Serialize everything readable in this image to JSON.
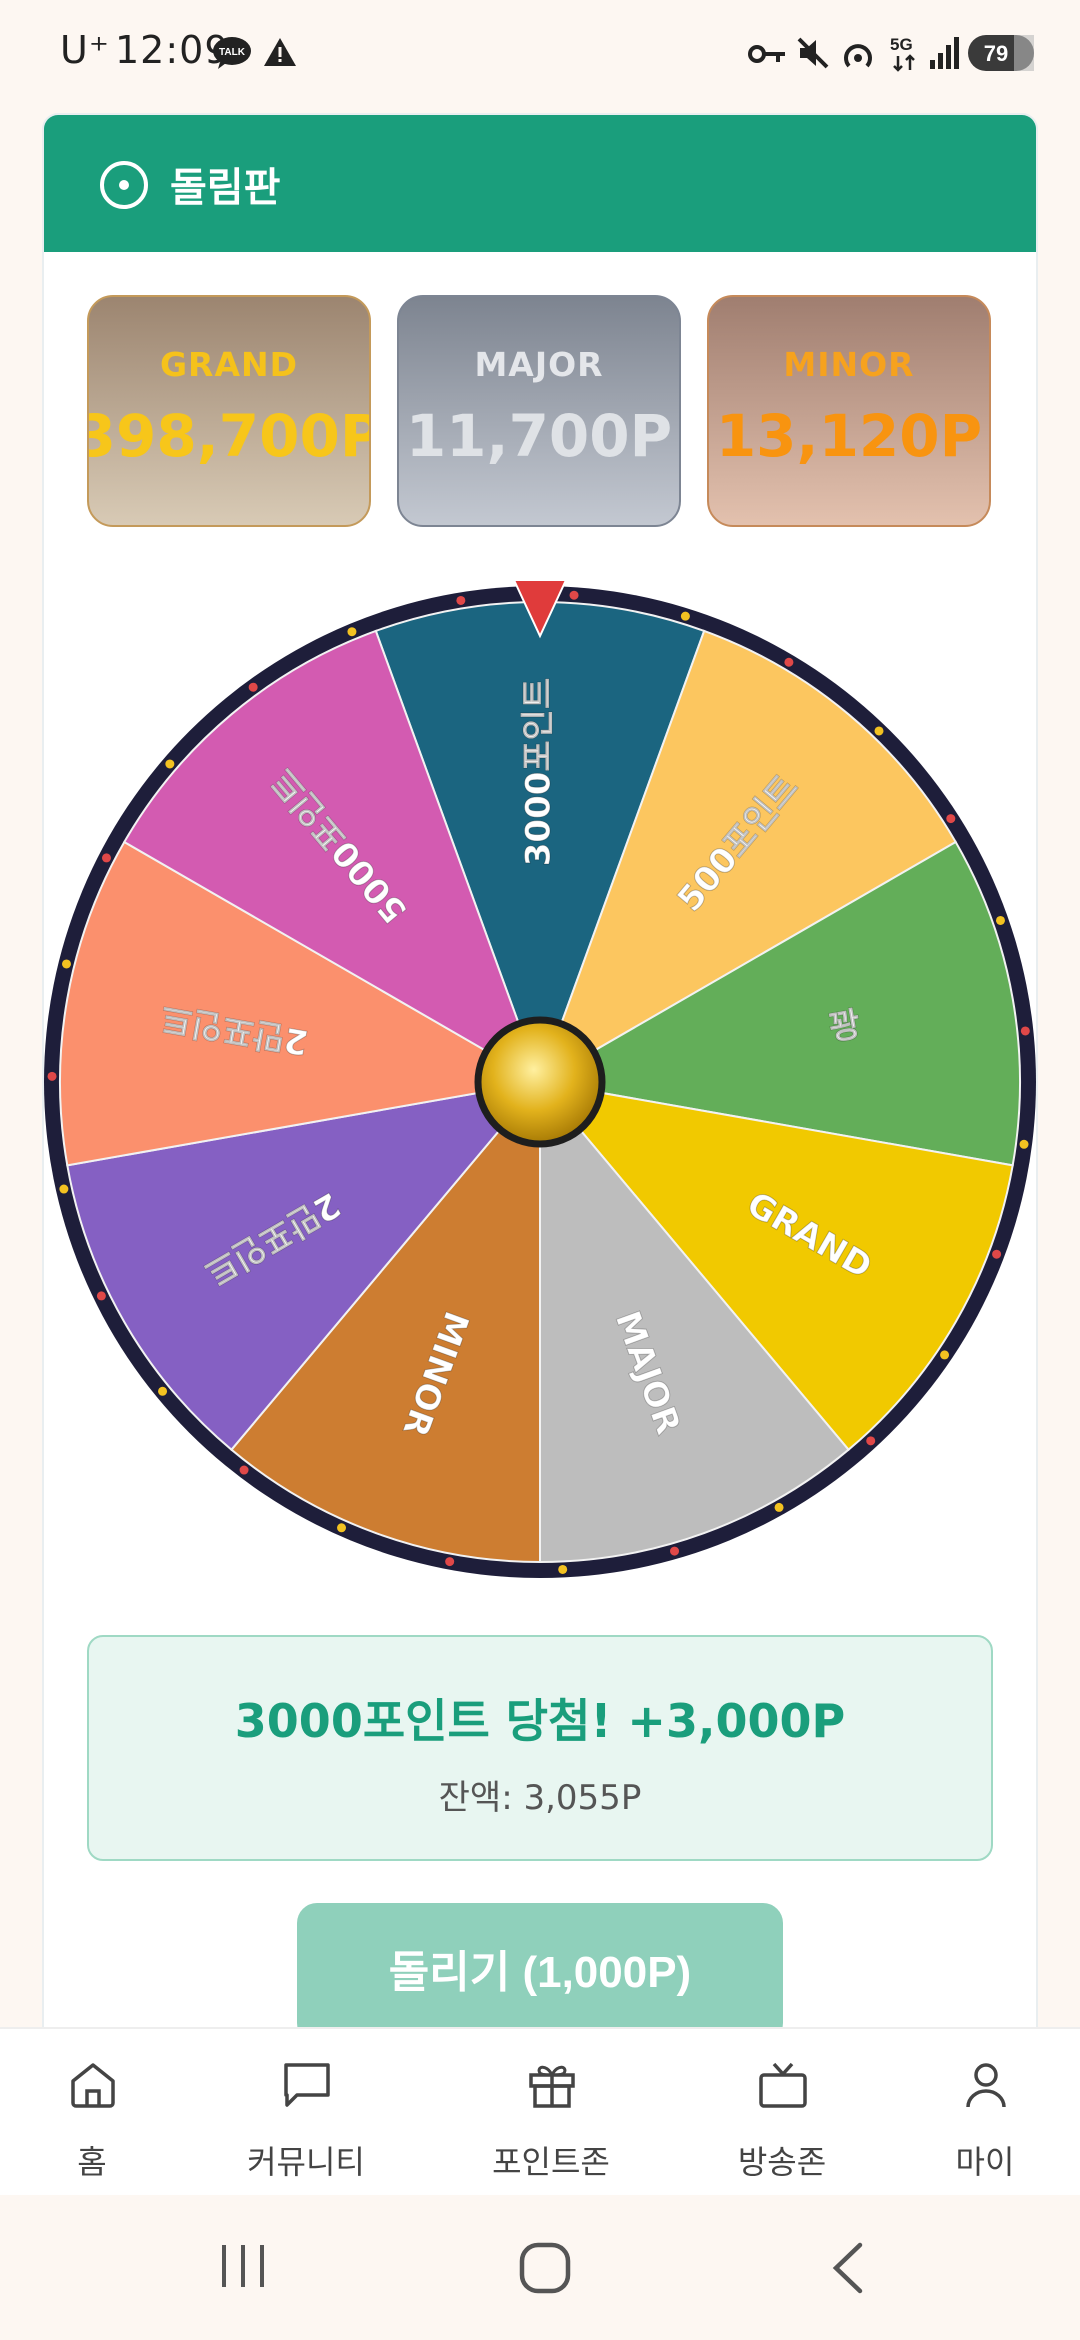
{
  "status_bar": {
    "carrier": "U⁺",
    "time": "12:09",
    "talk_icon_text": "TALK",
    "network": "5G",
    "battery": "79",
    "icons": [
      "kakaotalk-icon",
      "warning-icon",
      "key-icon",
      "mute-icon",
      "hotspot-icon",
      "5g-icon",
      "signal-icon",
      "battery-icon"
    ]
  },
  "card": {
    "title": "돌림판",
    "header_color": "#1a9e7c",
    "jackpots": [
      {
        "label": "GRAND",
        "value": "398,700P"
      },
      {
        "label": "MAJOR",
        "value": "11,700P"
      },
      {
        "label": "MINOR",
        "value": "13,120P"
      }
    ]
  },
  "wheel": {
    "segments": [
      {
        "label": "3000포인트",
        "color": "#1b6580"
      },
      {
        "label": "500포인트",
        "color": "#fcc65f"
      },
      {
        "label": "꽝",
        "color": "#63ae59"
      },
      {
        "label": "GRAND",
        "color": "#f1c900"
      },
      {
        "label": "MAJOR",
        "color": "#bdbdbd"
      },
      {
        "label": "MINOR",
        "color": "#cd7d31"
      },
      {
        "label": "2만포인트",
        "color": "#8560c3"
      },
      {
        "label": "2만포인트",
        "color": "#fb906d"
      },
      {
        "label": "5000포인트",
        "color": "#d35bb1"
      }
    ],
    "rim_color": "#1e1e3a",
    "pointer_color": "#e03b3b"
  },
  "result": {
    "message": "3000포인트 당첨! +3,000P",
    "balance": "잔액: 3,055P"
  },
  "spin_button": {
    "label": "돌리기 (1,000P)"
  },
  "bottom_nav": [
    {
      "label": "홈",
      "icon": "home-icon"
    },
    {
      "label": "커뮤니티",
      "icon": "chat-bubble-icon"
    },
    {
      "label": "포인트존",
      "icon": "gift-icon"
    },
    {
      "label": "방송존",
      "icon": "tv-icon"
    },
    {
      "label": "마이",
      "icon": "user-icon"
    }
  ],
  "system_nav": [
    "recent-apps-icon",
    "home-circle-icon",
    "back-icon"
  ]
}
